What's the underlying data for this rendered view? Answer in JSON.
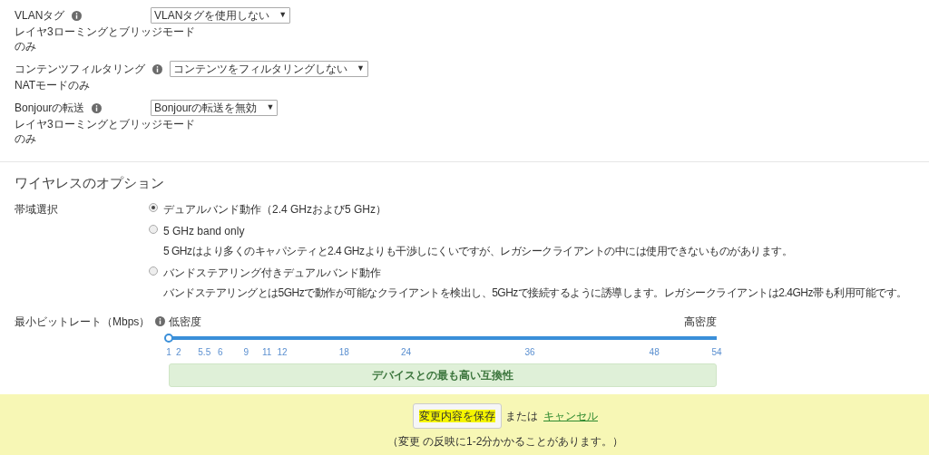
{
  "settings": [
    {
      "label": "VLANタグ",
      "note": "レイヤ3ローミングとブリッジモードのみ",
      "value": "VLANタグを使用しない",
      "arrow": "▼"
    },
    {
      "label": "コンテンツフィルタリング",
      "note": "NATモードのみ",
      "value": "コンテンツをフィルタリングしない",
      "arrow": "▼"
    },
    {
      "label": "Bonjourの転送",
      "note": "レイヤ3ローミングとブリッジモードのみ",
      "value": "Bonjourの転送を無効",
      "arrow": "▼"
    }
  ],
  "wireless": {
    "title": "ワイヤレスのオプション",
    "band": {
      "label": "帯域選択",
      "options": [
        {
          "label": "デュアルバンド動作（2.4 GHzおよび5 GHz）",
          "selected": true
        },
        {
          "label": "5 GHz band only",
          "description": "5 GHzはより多くのキャパシティと2.4 GHzよりも干渉しにくいですが、レガシークライアントの中には使用できないものがあります。",
          "selected": false
        },
        {
          "label": "バンドステアリング付きデュアルバンド動作",
          "description": "バンドステアリングとは5GHzで動作が可能なクライアントを検出し、5GHzで接続するように誘導します。レガシークライアントは2.4GHz帯も利用可能です。",
          "selected": false
        }
      ]
    },
    "bitrate": {
      "label": "最小ビットレート（Mbps）",
      "low": "低密度",
      "high": "高密度",
      "level": 0,
      "ticks": [
        "1",
        "2",
        "5.5",
        "6",
        "9",
        "11",
        "12",
        "18",
        "24",
        "36",
        "48",
        "54"
      ],
      "message": "デバイスとの最も高い互換性"
    }
  },
  "footer": {
    "save": "変更内容を保存",
    "or": "または",
    "cancel": "キャンセル",
    "note": "（変更 の反映に1-2分かかることがあります。）"
  }
}
